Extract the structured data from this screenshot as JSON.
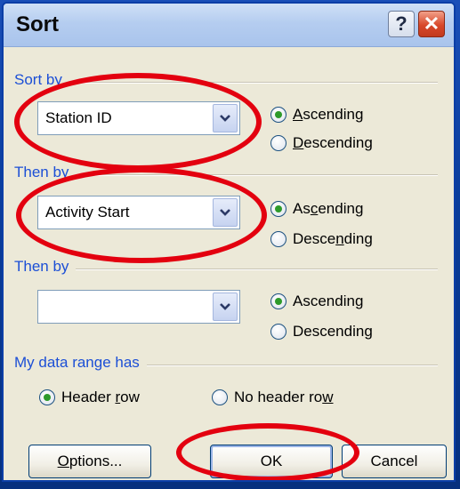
{
  "dialog": {
    "title": "Sort"
  },
  "titlebar": {
    "help_glyph": "?",
    "close_glyph": "✕"
  },
  "sort_by": {
    "label": "Sort by",
    "selected": "Station ID",
    "ascending": {
      "pre": "",
      "key": "A",
      "post": "scending"
    },
    "descending": {
      "pre": "",
      "key": "D",
      "post": "escending"
    },
    "order": "ascending"
  },
  "then_by_1": {
    "label": "Then by",
    "selected": "Activity Start",
    "ascending": {
      "pre": "As",
      "key": "c",
      "post": "ending"
    },
    "descending": {
      "pre": "Desce",
      "key": "n",
      "post": "ding"
    },
    "order": "ascending"
  },
  "then_by_2": {
    "label": "Then by",
    "selected": "",
    "ascending": {
      "pre": "Ascendin",
      "key": "g",
      "post": ""
    },
    "descending": {
      "pre": "Descendin",
      "key": "g",
      "post": ""
    },
    "order": "ascending"
  },
  "data_range": {
    "label": "My data range has",
    "header_row": {
      "pre": "Header ",
      "key": "r",
      "post": "ow"
    },
    "no_header_row": {
      "pre": "No header ro",
      "key": "w",
      "post": ""
    },
    "selected": "header_row"
  },
  "buttons": {
    "options": {
      "pre": "",
      "key": "O",
      "post": "ptions..."
    },
    "ok": "OK",
    "cancel": "Cancel"
  },
  "colors": {
    "group_label": "#1c4fd6",
    "annotation": "#e3000f",
    "radio_dot": "#2d9a2a"
  }
}
